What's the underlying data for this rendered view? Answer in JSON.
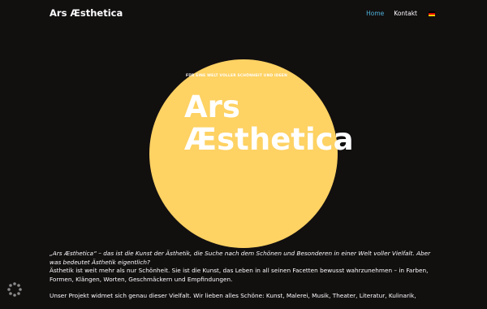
{
  "header": {
    "brand": "Ars Æsthetica",
    "nav": [
      {
        "label": "Home",
        "active": true
      },
      {
        "label": "Kontakt",
        "active": false
      }
    ],
    "language_flag": "german-flag-icon",
    "accent_color": "#4fb3d9"
  },
  "hero": {
    "tagline": "FÜR EINE WELT VOLLER SCHÖNHEIT UND IDEEN",
    "title_line1": "Ars",
    "title_line2": "Æsthetica",
    "circle_color": "#fed263"
  },
  "content": {
    "intro_italic": "„Ars Æsthetica“ – das ist die Kunst der Ästhetik, die Suche nach dem Schönen und Besonderen in einer Welt voller Vielfalt. Aber was bedeutet Ästhetik eigentlich?",
    "intro_text": "Ästhetik ist weit mehr als nur Schönheit. Sie ist die Kunst, das Leben in all seinen Facetten bewusst wahrzunehmen – in Farben, Formen, Klängen, Worten, Geschmäckern und Empfindungen.",
    "project_text": "Unser Projekt widmet sich genau dieser Vielfalt. Wir lieben alles Schöne: Kunst, Malerei, Musik, Theater, Literatur, Kulinarik,"
  },
  "widgets": {
    "spinner_icon": "loading-spinner-icon"
  }
}
